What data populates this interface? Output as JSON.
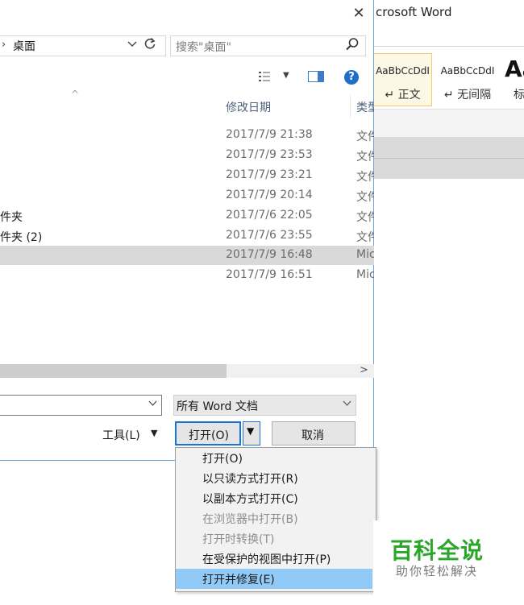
{
  "word": {
    "title": "crosoft Word",
    "styles": [
      {
        "sample": "AaBbCcDdI",
        "name": "↵ 正文"
      },
      {
        "sample": "AaBbCcDdI",
        "name": "↵ 无间隔"
      }
    ],
    "heading_sample": "Aa",
    "heading_label": "标"
  },
  "dialog": {
    "close_glyph": "✕",
    "address_chevron": "›",
    "address": "桌面",
    "search_placeholder": "搜索\"桌面\"",
    "help_glyph": "?",
    "columns": {
      "sort_glyph": "^",
      "date": "修改日期",
      "type": "类型"
    },
    "files": [
      {
        "name": "",
        "date": "2017/7/9 21:38",
        "type": "文件夹"
      },
      {
        "name": "",
        "date": "2017/7/9 23:53",
        "type": "文件夹"
      },
      {
        "name": "",
        "date": "2017/7/9 23:21",
        "type": "文件夹"
      },
      {
        "name": "",
        "date": "2017/7/9 20:14",
        "type": "文件夹"
      },
      {
        "name": "件夹",
        "date": "2017/7/6 22:05",
        "type": "文件夹"
      },
      {
        "name": "件夹 (2)",
        "date": "2017/7/6 23:55",
        "type": "文件夹"
      },
      {
        "name": "",
        "date": "2017/7/9 16:48",
        "type": "Microsoft Word",
        "selected": true
      },
      {
        "name": "",
        "date": "2017/7/9 16:51",
        "type": "Microsoft Word"
      }
    ],
    "scroll_right_glyph": ">",
    "filename_value": "",
    "filetype": "所有 Word 文档",
    "tools_label": "工具(L)",
    "open_label": "打开(O)",
    "cancel_label": "取消"
  },
  "open_menu": {
    "items": [
      {
        "label": "打开(O)",
        "enabled": true
      },
      {
        "label": "以只读方式打开(R)",
        "enabled": true
      },
      {
        "label": "以副本方式打开(C)",
        "enabled": true
      },
      {
        "label": "在浏览器中打开(B)",
        "enabled": false
      },
      {
        "label": "打开时转换(T)",
        "enabled": false
      },
      {
        "label": "在受保护的视图中打开(P)",
        "enabled": true
      },
      {
        "label": "打开并修复(E)",
        "enabled": true,
        "highlighted": true
      }
    ]
  },
  "watermark": {
    "title": "百科全说",
    "subtitle": "助你轻松解决"
  },
  "colors": {
    "accent": "#1a73d9",
    "selected_row": "#d9d9d9",
    "menu_highlight": "#91c9f7",
    "watermark_green": "#2aa62a"
  }
}
